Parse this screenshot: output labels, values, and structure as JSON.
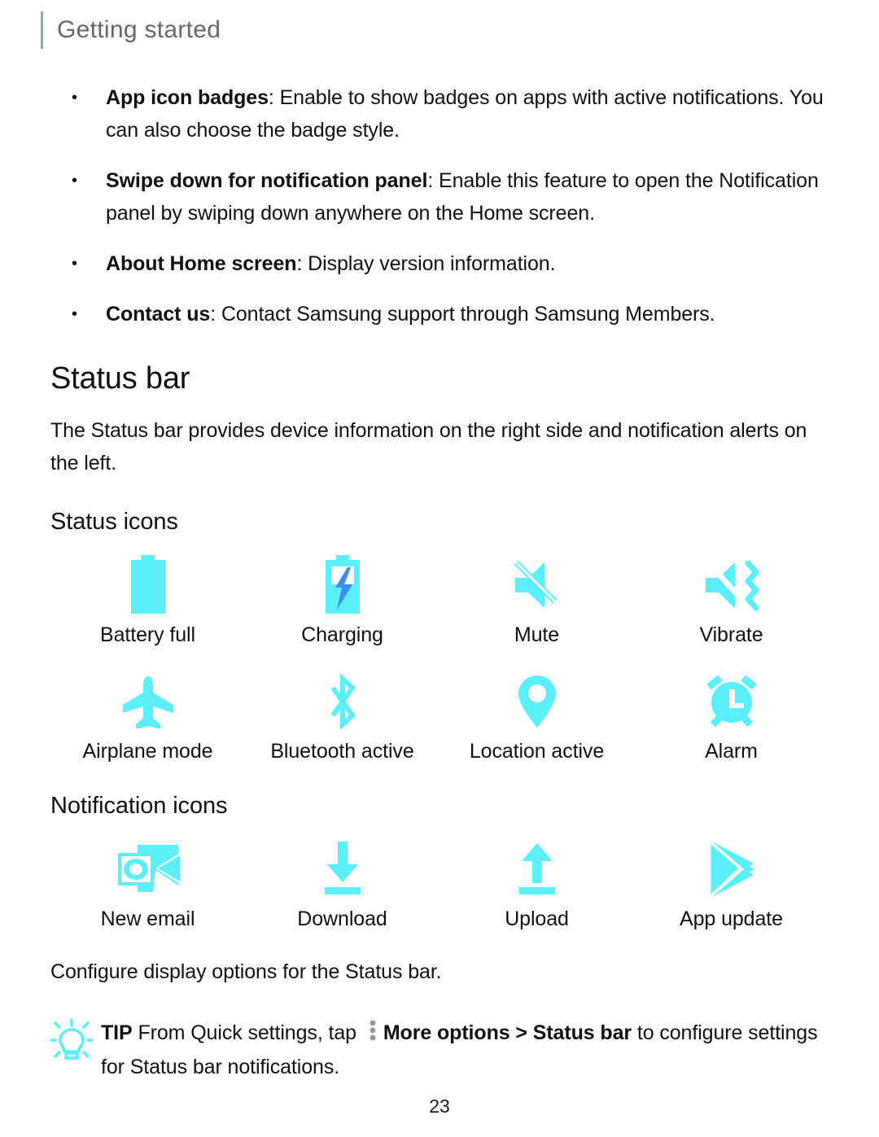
{
  "header": {
    "title": "Getting started"
  },
  "colors": {
    "icon_cyan": "#5BEEFB",
    "icon_blue": "#3B8EF0",
    "header_gray": "#5E6A72",
    "rule_gray": "#9AA3AA",
    "dots_gray": "#8A99A8"
  },
  "bullets": [
    {
      "term": "App icon badges",
      "separator": ":",
      "description": " Enable to show badges on apps with active notifications. You can also choose the badge style."
    },
    {
      "term": "Swipe down for notification panel",
      "separator": ":",
      "description": " Enable this feature to open the Notification panel by swiping down anywhere on the Home screen."
    },
    {
      "term": "About Home screen",
      "separator": ":",
      "description": " Display version information."
    },
    {
      "term": "Contact us",
      "separator": ":",
      "description": " Contact Samsung support through Samsung Members."
    }
  ],
  "status_bar_section": {
    "heading": "Status bar",
    "intro": "The Status bar provides device information on the right side and notification alerts on the left."
  },
  "status_icons": {
    "heading": "Status icons",
    "items": [
      {
        "icon": "battery-full-icon",
        "label": "Battery full"
      },
      {
        "icon": "battery-charging-icon",
        "label": "Charging"
      },
      {
        "icon": "mute-icon",
        "label": "Mute"
      },
      {
        "icon": "vibrate-icon",
        "label": "Vibrate"
      },
      {
        "icon": "airplane-mode-icon",
        "label": "Airplane mode"
      },
      {
        "icon": "bluetooth-icon",
        "label": "Bluetooth active"
      },
      {
        "icon": "location-pin-icon",
        "label": "Location active"
      },
      {
        "icon": "alarm-clock-icon",
        "label": "Alarm"
      }
    ]
  },
  "notification_icons": {
    "heading": "Notification icons",
    "items": [
      {
        "icon": "new-email-icon",
        "label": "New email"
      },
      {
        "icon": "download-icon",
        "label": "Download"
      },
      {
        "icon": "upload-icon",
        "label": "Upload"
      },
      {
        "icon": "app-update-icon",
        "label": "App update"
      }
    ]
  },
  "configure_text": "Configure display options for the Status bar.",
  "tip": {
    "label": "TIP",
    "text_before_dots": " From Quick settings, tap ",
    "more_options": "More options",
    "chevron": " > ",
    "status_bar": "Status bar",
    "text_after": " to configure settings for Status bar notifications."
  },
  "footer": {
    "page_number": "23"
  }
}
